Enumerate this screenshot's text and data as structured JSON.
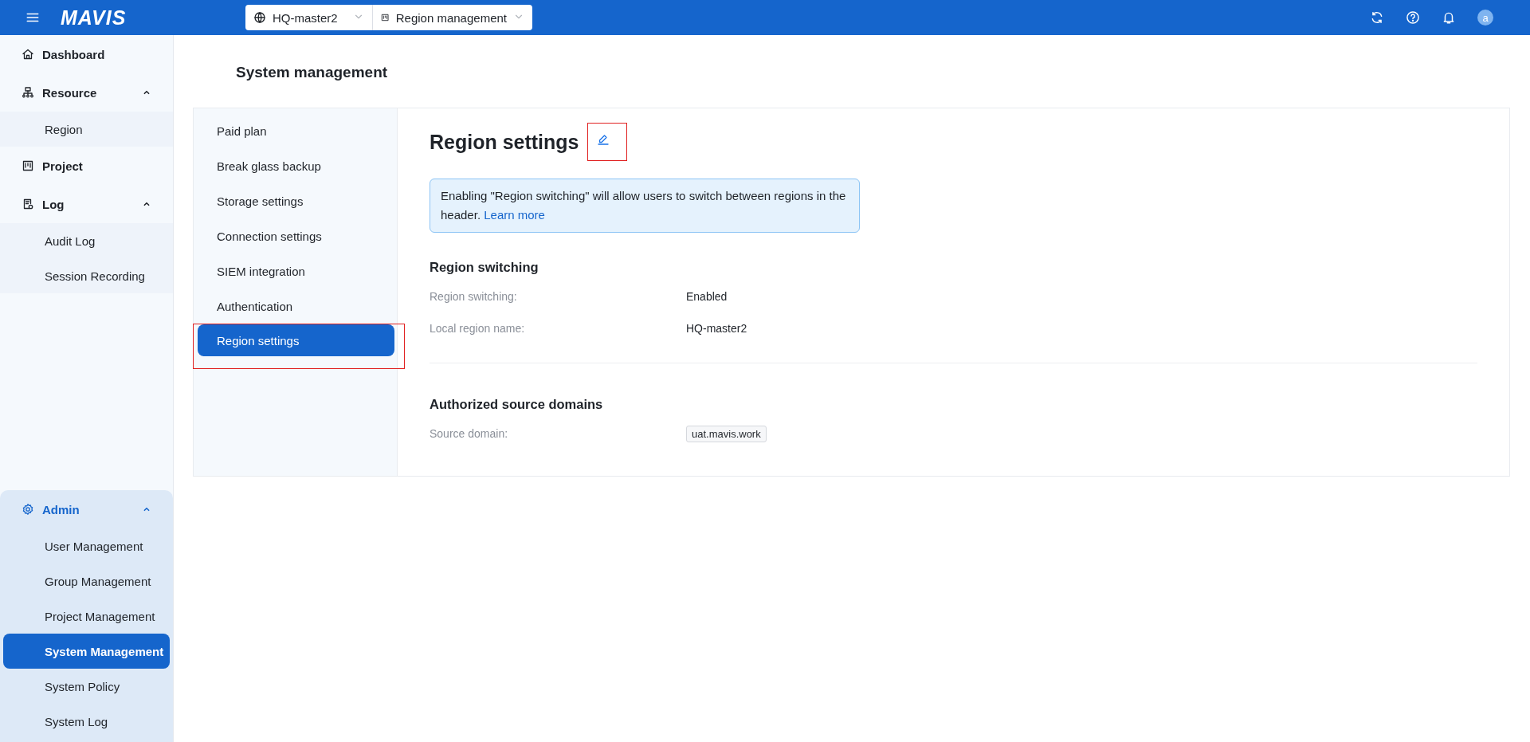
{
  "header": {
    "logo": "MAVIS",
    "region_selector": {
      "value": "HQ-master2"
    },
    "view_selector": {
      "value": "Region management"
    },
    "avatar": "a"
  },
  "sidebar": {
    "items": [
      {
        "label": "Dashboard",
        "kind": "link",
        "selected": false
      },
      {
        "label": "Resource",
        "kind": "group",
        "expanded": true,
        "children": [
          {
            "label": "Region",
            "selected": false
          }
        ]
      },
      {
        "label": "Project",
        "kind": "link",
        "selected": false
      },
      {
        "label": "Log",
        "kind": "group",
        "expanded": true,
        "children": [
          {
            "label": "Audit Log",
            "selected": false
          },
          {
            "label": "Session Recording",
            "selected": false
          }
        ]
      }
    ],
    "bottom_group": {
      "label": "Admin",
      "expanded": true,
      "children": [
        {
          "label": "User Management",
          "selected": false
        },
        {
          "label": "Group Management",
          "selected": false
        },
        {
          "label": "Project Management",
          "selected": false
        },
        {
          "label": "System Management",
          "selected": true
        },
        {
          "label": "System Policy",
          "selected": false
        },
        {
          "label": "System Log",
          "selected": false
        }
      ]
    }
  },
  "page": {
    "title": "System management",
    "settings_nav": [
      {
        "label": "Paid plan",
        "selected": false,
        "highlighted": false
      },
      {
        "label": "Break glass backup",
        "selected": false,
        "highlighted": false
      },
      {
        "label": "Storage settings",
        "selected": false,
        "highlighted": false
      },
      {
        "label": "Connection settings",
        "selected": false,
        "highlighted": false
      },
      {
        "label": "SIEM integration",
        "selected": false,
        "highlighted": false
      },
      {
        "label": "Authentication",
        "selected": false,
        "highlighted": false
      },
      {
        "label": "Region settings",
        "selected": true,
        "highlighted": true
      }
    ],
    "detail": {
      "title": "Region settings",
      "edit_highlighted": true,
      "notice": {
        "text": "Enabling \"Region switching\" will allow users to switch between regions in the header.",
        "link": "Learn more"
      },
      "sections": [
        {
          "title": "Region switching",
          "fields": [
            {
              "label": "Region switching:",
              "value": "Enabled",
              "kind": "text"
            },
            {
              "label": "Local region name:",
              "value": "HQ-master2",
              "kind": "text"
            }
          ]
        },
        {
          "title": "Authorized source domains",
          "fields": [
            {
              "label": "Source domain:",
              "value": "uat.mavis.work",
              "kind": "tag"
            }
          ]
        }
      ]
    }
  }
}
